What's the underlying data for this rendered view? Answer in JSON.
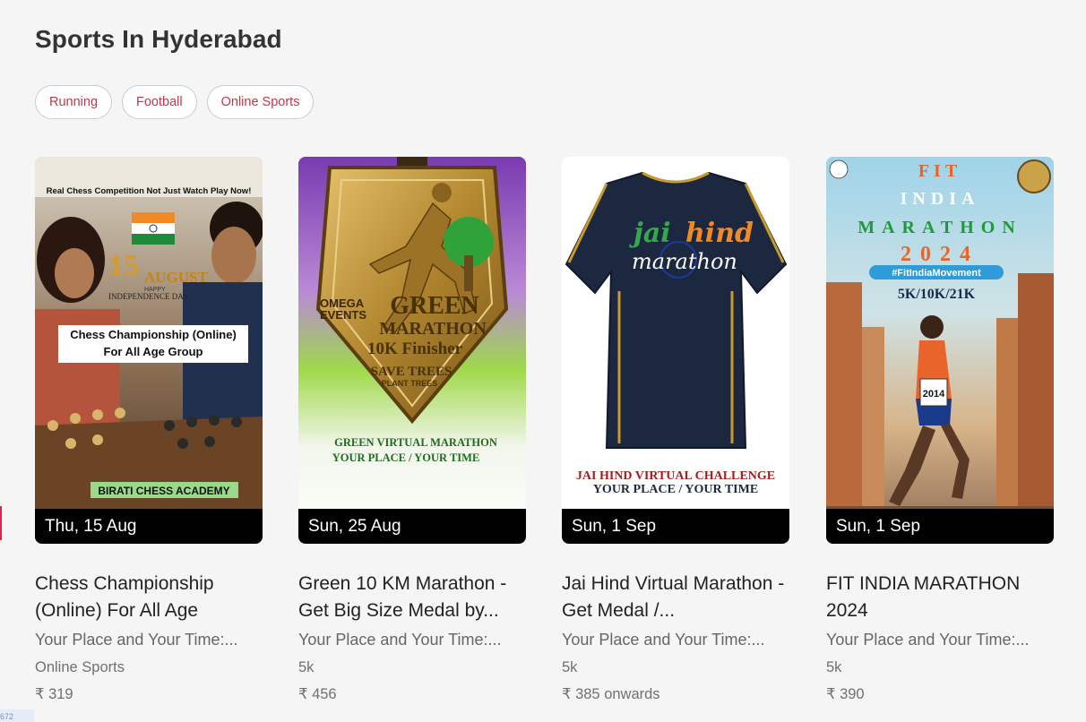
{
  "page": {
    "title": "Sports In Hyderabad"
  },
  "filters": [
    "Running",
    "Football",
    "Online Sports"
  ],
  "corner_tag": "672",
  "events": [
    {
      "date": "Thu, 15 Aug",
      "title": "Chess Championship (Online) For All Age",
      "venue": "Your Place and Your Time:...",
      "category": "Online Sports",
      "price": "₹ 319",
      "poster": {
        "top_banner": "Real Chess Competition Not Just Watch Play Now!",
        "day_number": "15",
        "month": "AUGUST",
        "occasion_line1": "HAPPY",
        "occasion_line2": "INDEPENDENCE DAY",
        "headline_line1": "Chess Championship (Online)",
        "headline_line2": "For All Age Group",
        "footer": "BIRATI CHESS ACADEMY"
      }
    },
    {
      "date": "Sun, 25 Aug",
      "title": "Green 10 KM Marathon - Get Big Size Medal by...",
      "venue": "Your Place and Your Time:...",
      "category": "5k",
      "price": "₹ 456",
      "poster": {
        "organizer_line1": "OMEGA",
        "organizer_line2": "EVENTS",
        "medal_line1": "GREEN",
        "medal_line2": "MARATHON",
        "medal_line3": "10K Finisher",
        "medal_line4": "SAVE TREES",
        "medal_line5": "PLANT TREES",
        "caption_line1": "GREEN VIRTUAL MARATHON",
        "caption_line2": "YOUR PLACE / YOUR TIME"
      }
    },
    {
      "date": "Sun, 1 Sep",
      "title": "Jai Hind Virtual Marathon - Get Medal /...",
      "venue": "Your Place and Your Time:...",
      "category": "5k",
      "price": "₹ 385 onwards",
      "poster": {
        "shirt_word1": "jai",
        "shirt_word2": "hind",
        "shirt_word3": "marathon",
        "caption_line1": "JAI HIND VIRTUAL CHALLENGE",
        "caption_line2": "YOUR PLACE / YOUR TIME"
      }
    },
    {
      "date": "Sun, 1 Sep",
      "title": "FIT INDIA MARATHON 2024",
      "venue": "Your Place and Your Time:...",
      "category": "5k",
      "price": "₹ 390",
      "poster": {
        "line1": "FIT",
        "line2": "INDIA",
        "line3": "MARATHON",
        "line4": "2024",
        "hashtag": "#FitIndiaMovement",
        "distances": "5K/10K/21K",
        "bib_number": "2014"
      }
    }
  ],
  "colors": {
    "background": "#f5f5f5",
    "chip_text": "#c0384b",
    "title_text": "#222222",
    "muted_text": "#666666"
  }
}
